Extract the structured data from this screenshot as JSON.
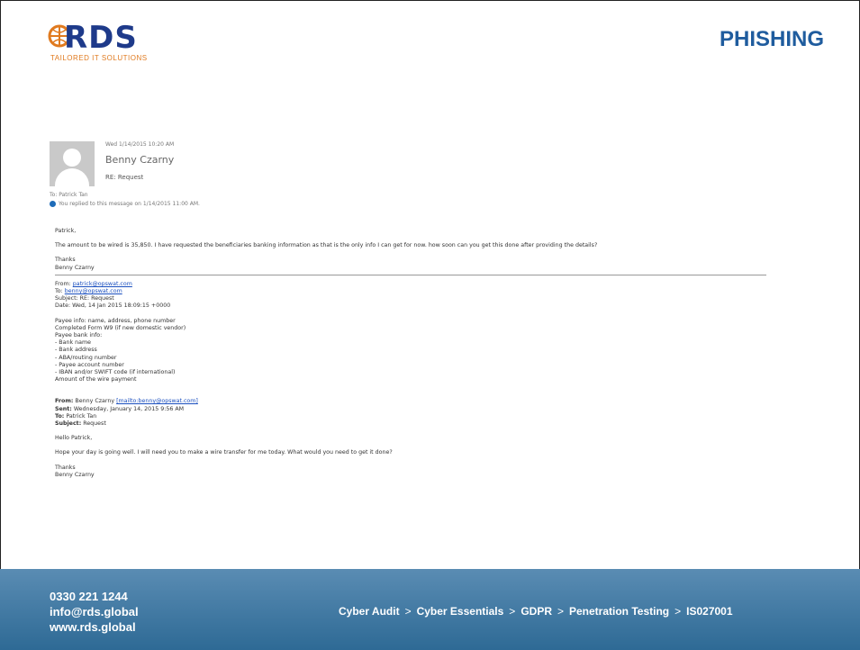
{
  "brand": {
    "name": "RDS",
    "tagline": "TAILORED IT SOLUTIONS"
  },
  "page": {
    "title": "PHISHING"
  },
  "email": {
    "date": "Wed 1/14/2015 10:20 AM",
    "sender": "Benny Czarny",
    "subject": "RE: Request",
    "to": "To: Patrick Tan",
    "replied_notice": "You replied to this message on 1/14/2015 11:00 AM.",
    "greeting": "Patrick,",
    "line1": "The amount to be wired is 35,850. I have requested the beneficiaries banking information as that is the only info I can get for now. how soon can you get this done after providing the details?",
    "thanks": "Thanks",
    "signature": "Benny Czarny",
    "quoted": {
      "from_label": "From: ",
      "from": "patrick@opswat.com",
      "to_label": "To: ",
      "to": "benny@opswat.com",
      "subject": "Subject: RE: Request",
      "date": "Date: Wed, 14 Jan 2015 18:09:15 +0000",
      "lines": [
        "Payee info: name, address, phone number",
        "Completed Form W9 (if new domestic vendor)",
        "Payee bank info:",
        "-        Bank name",
        "-        Bank address",
        "-        ABA/routing number",
        "-        Payee account number",
        "-        IBAN and/or SWIFT code (if international)",
        "Amount of the wire payment"
      ]
    },
    "original": {
      "from_label": "From:",
      "from_name": " Benny Czarny ",
      "from_link": "[mailto:benny@opswat.com]",
      "sent_label": "Sent:",
      "sent": " Wednesday, January 14, 2015 9:56 AM",
      "to_label": "To:",
      "to": " Patrick Tan",
      "subject_label": "Subject:",
      "subject": " Request",
      "greeting": "Hello Patrick,",
      "line1": "Hope your day is going well. I will need you to make a wire transfer for me today. What would you need to get it done?",
      "thanks": "Thanks",
      "signature": "Benny Czarny"
    }
  },
  "footer": {
    "phone": "0330 221 1244",
    "email": "info@rds.global",
    "web": "www.rds.global",
    "services": [
      "Cyber Audit",
      "Cyber Essentials",
      "GDPR",
      "Penetration Testing",
      "IS027001"
    ],
    "separator": ">"
  },
  "colors": {
    "title": "#1f5c9e",
    "logo": "#1e3a8a",
    "logo_accent": "#e07a1f",
    "footer_top": "#5a8cb3",
    "footer_bottom": "#2e6a95"
  }
}
